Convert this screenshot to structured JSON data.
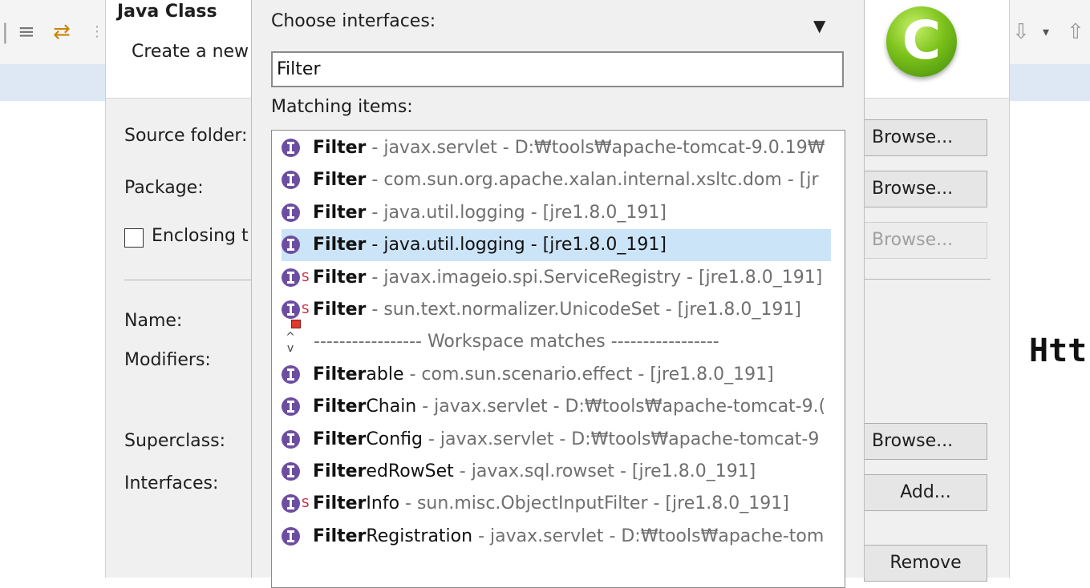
{
  "background": {
    "editor_code_text": "Htt"
  },
  "wizard": {
    "title": "Java Class",
    "description": "Create a new",
    "labels": {
      "source_folder": "Source folder:",
      "package": "Package:",
      "enclosing": "Enclosing t",
      "name": "Name:",
      "modifiers": "Modifiers:",
      "superclass": "Superclass:",
      "interfaces": "Interfaces:"
    },
    "buttons": {
      "browse_source": "Browse...",
      "browse_package": "Browse...",
      "browse_enclosing": "Browse...",
      "browse_superclass": "Browse...",
      "add": "Add...",
      "remove": "Remove"
    },
    "logo_letter": "C"
  },
  "dialog": {
    "choose_label": "Choose interfaces:",
    "filter_value": "Filter",
    "matching_label": "Matching items:",
    "separator_text": "----------------- Workspace matches -----------------",
    "results": [
      {
        "match": "Filter",
        "rest": "",
        "detail": " - javax.servlet - D:₩tools₩apache-tomcat-9.0.19₩",
        "icon": "interface-icon",
        "selected": false
      },
      {
        "match": "Filter",
        "rest": "",
        "detail": " - com.sun.org.apache.xalan.internal.xsltc.dom - [jr",
        "icon": "interface-icon",
        "selected": false
      },
      {
        "match": "Filter",
        "rest": "",
        "detail": " - java.util.logging - [jre1.8.0_191]",
        "icon": "interface-icon",
        "selected": false
      },
      {
        "match": "Filter",
        "rest": "",
        "detail": " - java.util.logging - [jre1.8.0_191]",
        "icon": "interface-icon",
        "selected": true
      },
      {
        "match": "Filter",
        "rest": "",
        "detail": " - javax.imageio.spi.ServiceRegistry - [jre1.8.0_191]",
        "icon": "static-interface-icon",
        "selected": false
      },
      {
        "match": "Filter",
        "rest": "",
        "detail": " - sun.text.normalizer.UnicodeSet - [jre1.8.0_191]",
        "icon": "private-static-interface-icon",
        "selected": false
      },
      {
        "match": "Filter",
        "rest": "able",
        "detail": " - com.sun.scenario.effect - [jre1.8.0_191]",
        "icon": "interface-icon",
        "selected": false
      },
      {
        "match": "Filter",
        "rest": "Chain",
        "detail": " - javax.servlet - D:₩tools₩apache-tomcat-9.(",
        "icon": "interface-icon",
        "selected": false
      },
      {
        "match": "Filter",
        "rest": "Config",
        "detail": " - javax.servlet - D:₩tools₩apache-tomcat-9",
        "icon": "interface-icon",
        "selected": false
      },
      {
        "match": "Filter",
        "rest": "edRowSet",
        "detail": " - javax.sql.rowset - [jre1.8.0_191]",
        "icon": "interface-icon",
        "selected": false
      },
      {
        "match": "Filter",
        "rest": "Info",
        "detail": " - sun.misc.ObjectInputFilter - [jre1.8.0_191]",
        "icon": "static-interface-icon",
        "selected": false
      },
      {
        "match": "Filter",
        "rest": "Registration",
        "detail": " - javax.servlet - D:₩tools₩apache-tom",
        "icon": "interface-icon",
        "selected": false
      }
    ]
  }
}
